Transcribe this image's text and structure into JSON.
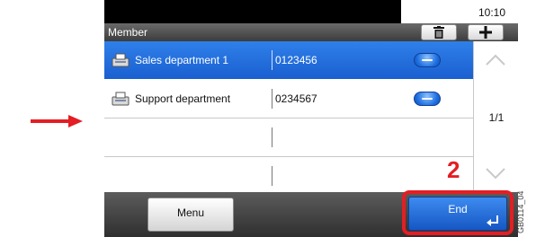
{
  "status": {
    "time": "10:10"
  },
  "header": {
    "title": "Member",
    "delete_icon": "trash-icon",
    "add_icon": "plus-icon"
  },
  "rows": [
    {
      "name": "Sales department 1",
      "number": "0123456",
      "icon": "fax-icon",
      "selected": true
    },
    {
      "name": "Support department",
      "number": "0234567",
      "icon": "fax-icon",
      "selected": false
    },
    {
      "name": "",
      "number": "",
      "selected": false
    },
    {
      "name": "",
      "number": "",
      "selected": false
    }
  ],
  "pager": {
    "page": "1/1"
  },
  "footer": {
    "menu_label": "Menu",
    "end_label": "End"
  },
  "annotations": {
    "step_number": "2",
    "figure_code": "GB0114_04",
    "arrow_color": "#e31e24",
    "highlight_color": "#e31e24"
  }
}
